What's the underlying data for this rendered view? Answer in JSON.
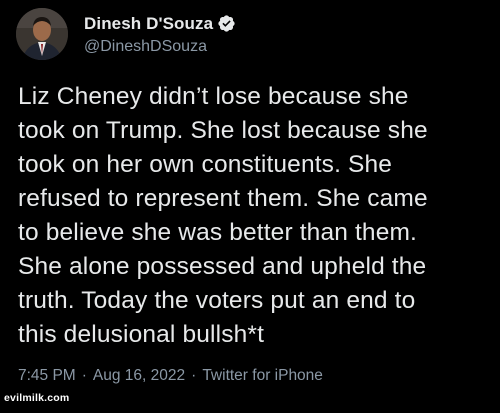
{
  "author": {
    "display_name": "Dinesh D'Souza",
    "handle": "@DineshDSouza",
    "verified": true,
    "avatar_icon": "profile-photo"
  },
  "tweet": {
    "text": "Liz Cheney didn’t lose because she\ntook on Trump. She lost because she\ntook on her own constituents. She\nrefused to represent them. She came\nto believe she was better than them.\nShe alone possessed and upheld the\ntruth. Today the voters put an end to\nthis delusional bullsh*t"
  },
  "meta": {
    "time": "7:45 PM",
    "separator": "·",
    "date": "Aug 16, 2022",
    "source": "Twitter for iPhone"
  },
  "watermark": {
    "text": "evilmilk.com"
  },
  "colors": {
    "background": "#000000",
    "primary_text": "#e7e9ea",
    "secondary_text": "#8b98a5",
    "verified_badge": "#1d9bf0"
  }
}
